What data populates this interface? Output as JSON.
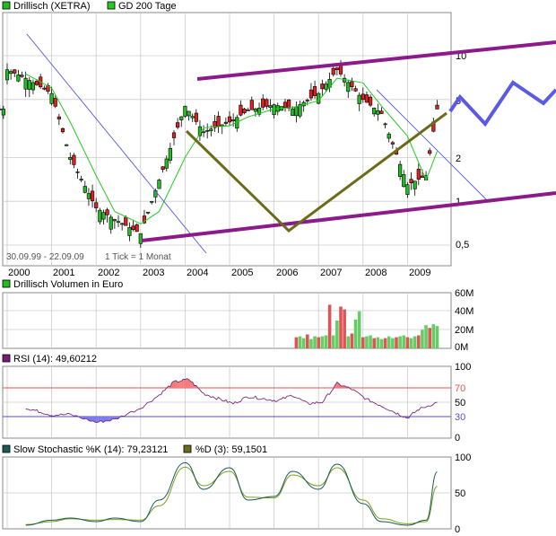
{
  "colors": {
    "up": "#22bb22",
    "down": "#dd2222",
    "gd200": "#22cc22",
    "channel": "#8b1a8b",
    "pattern": "#6b6b1a",
    "forecast": "#5a5ae6",
    "trendline": "#5555dd",
    "rsi_line": "#7a2a7a",
    "rsi_over": "#f47a7a",
    "rsi_under": "#7a7af0",
    "stoch_k": "#1a5a5a",
    "stoch_d": "#7aa01a",
    "grid": "#cccccc",
    "volume_up": "#66cc66",
    "volume_down": "#dd5555"
  },
  "legend": {
    "series1": "Drillisch (XETRA)",
    "series2": "GD 200 Tage"
  },
  "info": {
    "period": "30.09.99 - 22.09.09",
    "tick": "1 Tick = 1 Monat"
  },
  "chart_data": [
    {
      "type": "candlestick",
      "title": "Drillisch (XETRA)",
      "scale": "log",
      "y_ticks": [
        "0,5",
        "1",
        "2",
        "5",
        "10"
      ],
      "x_ticks": [
        "2000",
        "2001",
        "2002",
        "2003",
        "2004",
        "2005",
        "2006",
        "2007",
        "2008",
        "2009"
      ],
      "series": [
        {
          "name": "Drillisch (XETRA)",
          "x": [
            "2000-01",
            "2000-06",
            "2001-01",
            "2001-06",
            "2002-01",
            "2002-06",
            "2003-01",
            "2003-06",
            "2004-01",
            "2004-06",
            "2005-01",
            "2005-06",
            "2006-01",
            "2006-06",
            "2007-01",
            "2007-06",
            "2008-01",
            "2008-06",
            "2009-01",
            "2009-06",
            "2009-09"
          ],
          "values": [
            8.0,
            7.0,
            5.5,
            2.0,
            0.9,
            0.75,
            0.6,
            1.4,
            4.5,
            3.0,
            3.5,
            4.2,
            4.6,
            4.3,
            5.5,
            8.0,
            5.0,
            4.0,
            1.3,
            1.5,
            4.3
          ]
        },
        {
          "name": "GD 200 Tage",
          "x": [
            "2000-06",
            "2001-01",
            "2001-06",
            "2002-01",
            "2002-06",
            "2003-01",
            "2003-06",
            "2004-01",
            "2004-06",
            "2005-01",
            "2005-06",
            "2006-01",
            "2006-06",
            "2007-01",
            "2007-06",
            "2008-01",
            "2008-06",
            "2009-01",
            "2009-06",
            "2009-09"
          ],
          "values": [
            7.5,
            6.0,
            3.5,
            1.5,
            0.85,
            0.7,
            0.85,
            2.0,
            3.2,
            3.3,
            3.8,
            4.3,
            4.4,
            4.9,
            7.0,
            6.5,
            4.5,
            2.8,
            1.4,
            2.2
          ]
        }
      ]
    },
    {
      "type": "bar",
      "title": "Drillisch Volumen in Euro",
      "y_ticks": [
        "0M",
        "20M",
        "40M",
        "60M"
      ],
      "ylim": [
        0,
        60
      ],
      "series": [
        {
          "name": "Drillisch Volumen in Euro",
          "x": [
            "2006-07",
            "2006-08",
            "2006-09",
            "2006-10",
            "2006-11",
            "2006-12",
            "2007-01",
            "2007-02",
            "2007-03",
            "2007-04",
            "2007-05",
            "2007-06",
            "2007-07",
            "2007-08",
            "2007-09",
            "2007-10",
            "2007-11",
            "2007-12",
            "2008-01",
            "2008-02",
            "2008-03",
            "2008-04",
            "2008-05",
            "2008-06",
            "2008-07",
            "2008-08",
            "2008-09",
            "2008-10",
            "2008-11",
            "2008-12",
            "2009-01",
            "2009-02",
            "2009-03",
            "2009-04",
            "2009-05",
            "2009-06",
            "2009-07",
            "2009-08",
            "2009-09"
          ],
          "values": [
            12,
            13,
            11,
            15,
            10,
            13,
            12,
            13,
            14,
            47,
            14,
            30,
            45,
            42,
            13,
            16,
            31,
            40,
            12,
            13,
            14,
            11,
            12,
            10,
            11,
            13,
            11,
            12,
            13,
            14,
            12,
            11,
            13,
            14,
            20,
            25,
            22,
            26,
            24
          ]
        }
      ]
    },
    {
      "type": "line",
      "title": "RSI (14): 49,60212",
      "y_ticks": [
        "0",
        "30",
        "50",
        "70",
        "100"
      ],
      "ylim": [
        0,
        100
      ],
      "series": [
        {
          "name": "RSI (14): 49,60212",
          "x": [
            "2000-06",
            "2000-09",
            "2001-01",
            "2001-06",
            "2002-01",
            "2002-06",
            "2003-01",
            "2003-06",
            "2003-10",
            "2004-02",
            "2004-06",
            "2004-10",
            "2005-02",
            "2005-06",
            "2005-10",
            "2006-02",
            "2006-06",
            "2006-10",
            "2007-02",
            "2007-06",
            "2007-10",
            "2008-02",
            "2008-06",
            "2008-10",
            "2009-01",
            "2009-04",
            "2009-09"
          ],
          "values": [
            42,
            38,
            32,
            33,
            22,
            26,
            42,
            60,
            78,
            82,
            62,
            55,
            48,
            58,
            55,
            52,
            60,
            48,
            50,
            76,
            68,
            54,
            45,
            35,
            28,
            40,
            50
          ]
        }
      ]
    },
    {
      "type": "line",
      "title": "Slow Stochastic",
      "y_ticks": [
        "0",
        "50",
        "100"
      ],
      "ylim": [
        0,
        100
      ],
      "series": [
        {
          "name": "Slow Stochastic %K (14): 79,23121",
          "x": [
            "2000-06",
            "2001-01",
            "2001-06",
            "2002-01",
            "2002-06",
            "2003-01",
            "2003-06",
            "2004-01",
            "2004-06",
            "2005-01",
            "2005-06",
            "2006-01",
            "2006-06",
            "2007-01",
            "2007-06",
            "2008-01",
            "2008-06",
            "2009-01",
            "2009-06",
            "2009-09"
          ],
          "values": [
            5,
            12,
            15,
            10,
            15,
            10,
            40,
            92,
            55,
            85,
            40,
            45,
            80,
            55,
            90,
            35,
            10,
            5,
            12,
            79
          ]
        },
        {
          "name": "%D (3): 59,1501",
          "x": [
            "2000-06",
            "2001-01",
            "2001-06",
            "2002-01",
            "2002-06",
            "2003-01",
            "2003-06",
            "2004-01",
            "2004-06",
            "2005-01",
            "2005-06",
            "2006-01",
            "2006-06",
            "2007-01",
            "2007-06",
            "2008-01",
            "2008-06",
            "2009-01",
            "2009-06",
            "2009-09"
          ],
          "values": [
            6,
            10,
            14,
            12,
            13,
            12,
            32,
            86,
            60,
            80,
            44,
            43,
            75,
            60,
            85,
            40,
            14,
            7,
            10,
            59
          ]
        }
      ]
    }
  ],
  "panels": {
    "volume_legend": "Drillisch Volumen in Euro",
    "rsi_legend": "RSI (14): 49,60212",
    "stoch_k_legend": "Slow Stochastic %K (14): 79,23121",
    "stoch_d_legend": "%D (3): 59,1501"
  }
}
